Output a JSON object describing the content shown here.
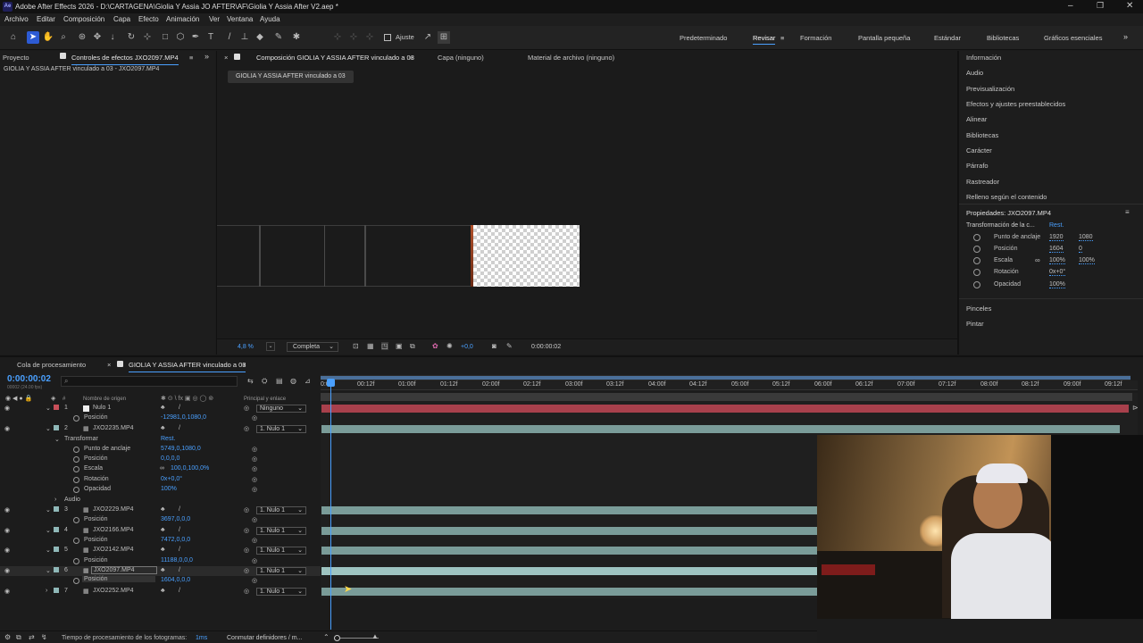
{
  "app": {
    "title": "Adobe After Effects 2026 - D:\\CARTAGENA\\Giolia Y Assia JO AFTER\\AF\\Giolia Y Assia After V2.aep *",
    "logo": "Ae"
  },
  "menu": [
    "Archivo",
    "Editar",
    "Composición",
    "Capa",
    "Efecto",
    "Animación",
    "Ver",
    "Ventana",
    "Ayuda"
  ],
  "toolbar": {
    "snap_label": "Ajuste",
    "workspaces": [
      "Predeterminado",
      "Revisar",
      "Formación",
      "Pantalla pequeña",
      "Estándar",
      "Bibliotecas",
      "Gráficos esenciales"
    ],
    "active_workspace": "Revisar",
    "more": "»"
  },
  "left_panel": {
    "tab_project": "Proyecto",
    "tab_effects": "Controles de efectos JXO2097.MP4",
    "more": "»",
    "subtitle": "GIOLIA Y ASSIA AFTER vinculado a 03 - JXO2097.MP4"
  },
  "comp_panel": {
    "tab_comp": "Composición GIOLIA Y ASSIA AFTER vinculado a 03",
    "tab_layer": "Capa (ninguno)",
    "tab_footage": "Material de archivo (ninguno)",
    "breadcrumb": "GIOLIA Y ASSIA AFTER vinculado a 03",
    "zoom": "4,8 %",
    "resolution": "Completa",
    "exposure": "+0,0",
    "timecode": "0:00:00:02"
  },
  "right_panel": {
    "items": [
      "Información",
      "Audio",
      "Previsualización",
      "Efectos y ajustes preestablecidos",
      "Alinear",
      "Bibliotecas",
      "Carácter",
      "Párrafo",
      "Rastreador",
      "Relleno según el contenido"
    ],
    "properties_title": "Propiedades: JXO2097.MP4",
    "transform_label": "Transformación de la c...",
    "reset": "Rest.",
    "props": {
      "anchor": {
        "label": "Punto de anclaje",
        "v1": "1920",
        "v2": "1080"
      },
      "position": {
        "label": "Posición",
        "v1": "1604",
        "v2": "0"
      },
      "scale": {
        "label": "Escala",
        "v1": "100%",
        "v2": "100%"
      },
      "rotation": {
        "label": "Rotación",
        "v1": "0x+0°"
      },
      "opacity": {
        "label": "Opacidad",
        "v1": "100%"
      }
    },
    "brushes": "Pinceles",
    "paint": "Pintar"
  },
  "timeline": {
    "tab_queue": "Cola de procesamiento",
    "tab_comp": "GIOLIA Y ASSIA AFTER vinculado a 03",
    "timecode": "0:00:00:02",
    "fps": "00002 (24.00 fps)",
    "search_placeholder": "",
    "col_hash": "#",
    "col_source": "Nombre de origen",
    "col_parent": "Principal y enlace",
    "ruler": [
      "0:00f",
      "00:12f",
      "01:00f",
      "01:12f",
      "02:00f",
      "02:12f",
      "03:00f",
      "03:12f",
      "04:00f",
      "04:12f",
      "05:00f",
      "05:12f",
      "06:00f",
      "06:12f",
      "07:00f",
      "07:12f",
      "08:00f",
      "08:12f",
      "09:00f",
      "09:12f"
    ],
    "layers": {
      "l1": {
        "num": "1",
        "name": "Nulo 1",
        "parent": "Ninguno",
        "pos_label": "Posición",
        "pos": "-12981,0,1080,0",
        "color": "#c8505a"
      },
      "l2": {
        "num": "2",
        "name": "JXO2235.MP4",
        "parent": "1. Nulo 1",
        "color": "#8fb8b8",
        "transform": "Transformar",
        "reset": "Rest.",
        "anchor_label": "Punto de anclaje",
        "anchor": "5749,0,1080,0",
        "pos_label": "Posición",
        "pos": "0,0,0,0",
        "scale_label": "Escala",
        "scale": "100,0,100,0%",
        "rot_label": "Rotación",
        "rot": "0x+0,0°",
        "op_label": "Opacidad",
        "op": "100%",
        "audio": "Audio"
      },
      "l3": {
        "num": "3",
        "name": "JXO2229.MP4",
        "parent": "1. Nulo 1",
        "pos_label": "Posición",
        "pos": "3697,0,0,0"
      },
      "l4": {
        "num": "4",
        "name": "JXO2166.MP4",
        "parent": "1. Nulo 1",
        "pos_label": "Posición",
        "pos": "7472,0,0,0"
      },
      "l5": {
        "num": "5",
        "name": "JXO2142.MP4",
        "parent": "1. Nulo 1",
        "pos_label": "Posición",
        "pos": "11188,0,0,0"
      },
      "l6": {
        "num": "6",
        "name": "JXO2097.MP4",
        "parent": "1. Nulo 1",
        "pos_label": "Posición",
        "pos": "1604,0,0,0"
      },
      "l7": {
        "num": "7",
        "name": "JXO2252.MP4",
        "parent": "1. Nulo 1"
      }
    },
    "footer_render": "Tiempo de procesamiento de los fotogramas:",
    "footer_ms": "1ms",
    "footer_toggle": "Conmutar definidores / m..."
  },
  "colors": {
    "accent": "#4aa0ff",
    "null_bar": "#b0404e",
    "clip_bar": "#86a9a6",
    "playhead": "#4aa0ff"
  }
}
